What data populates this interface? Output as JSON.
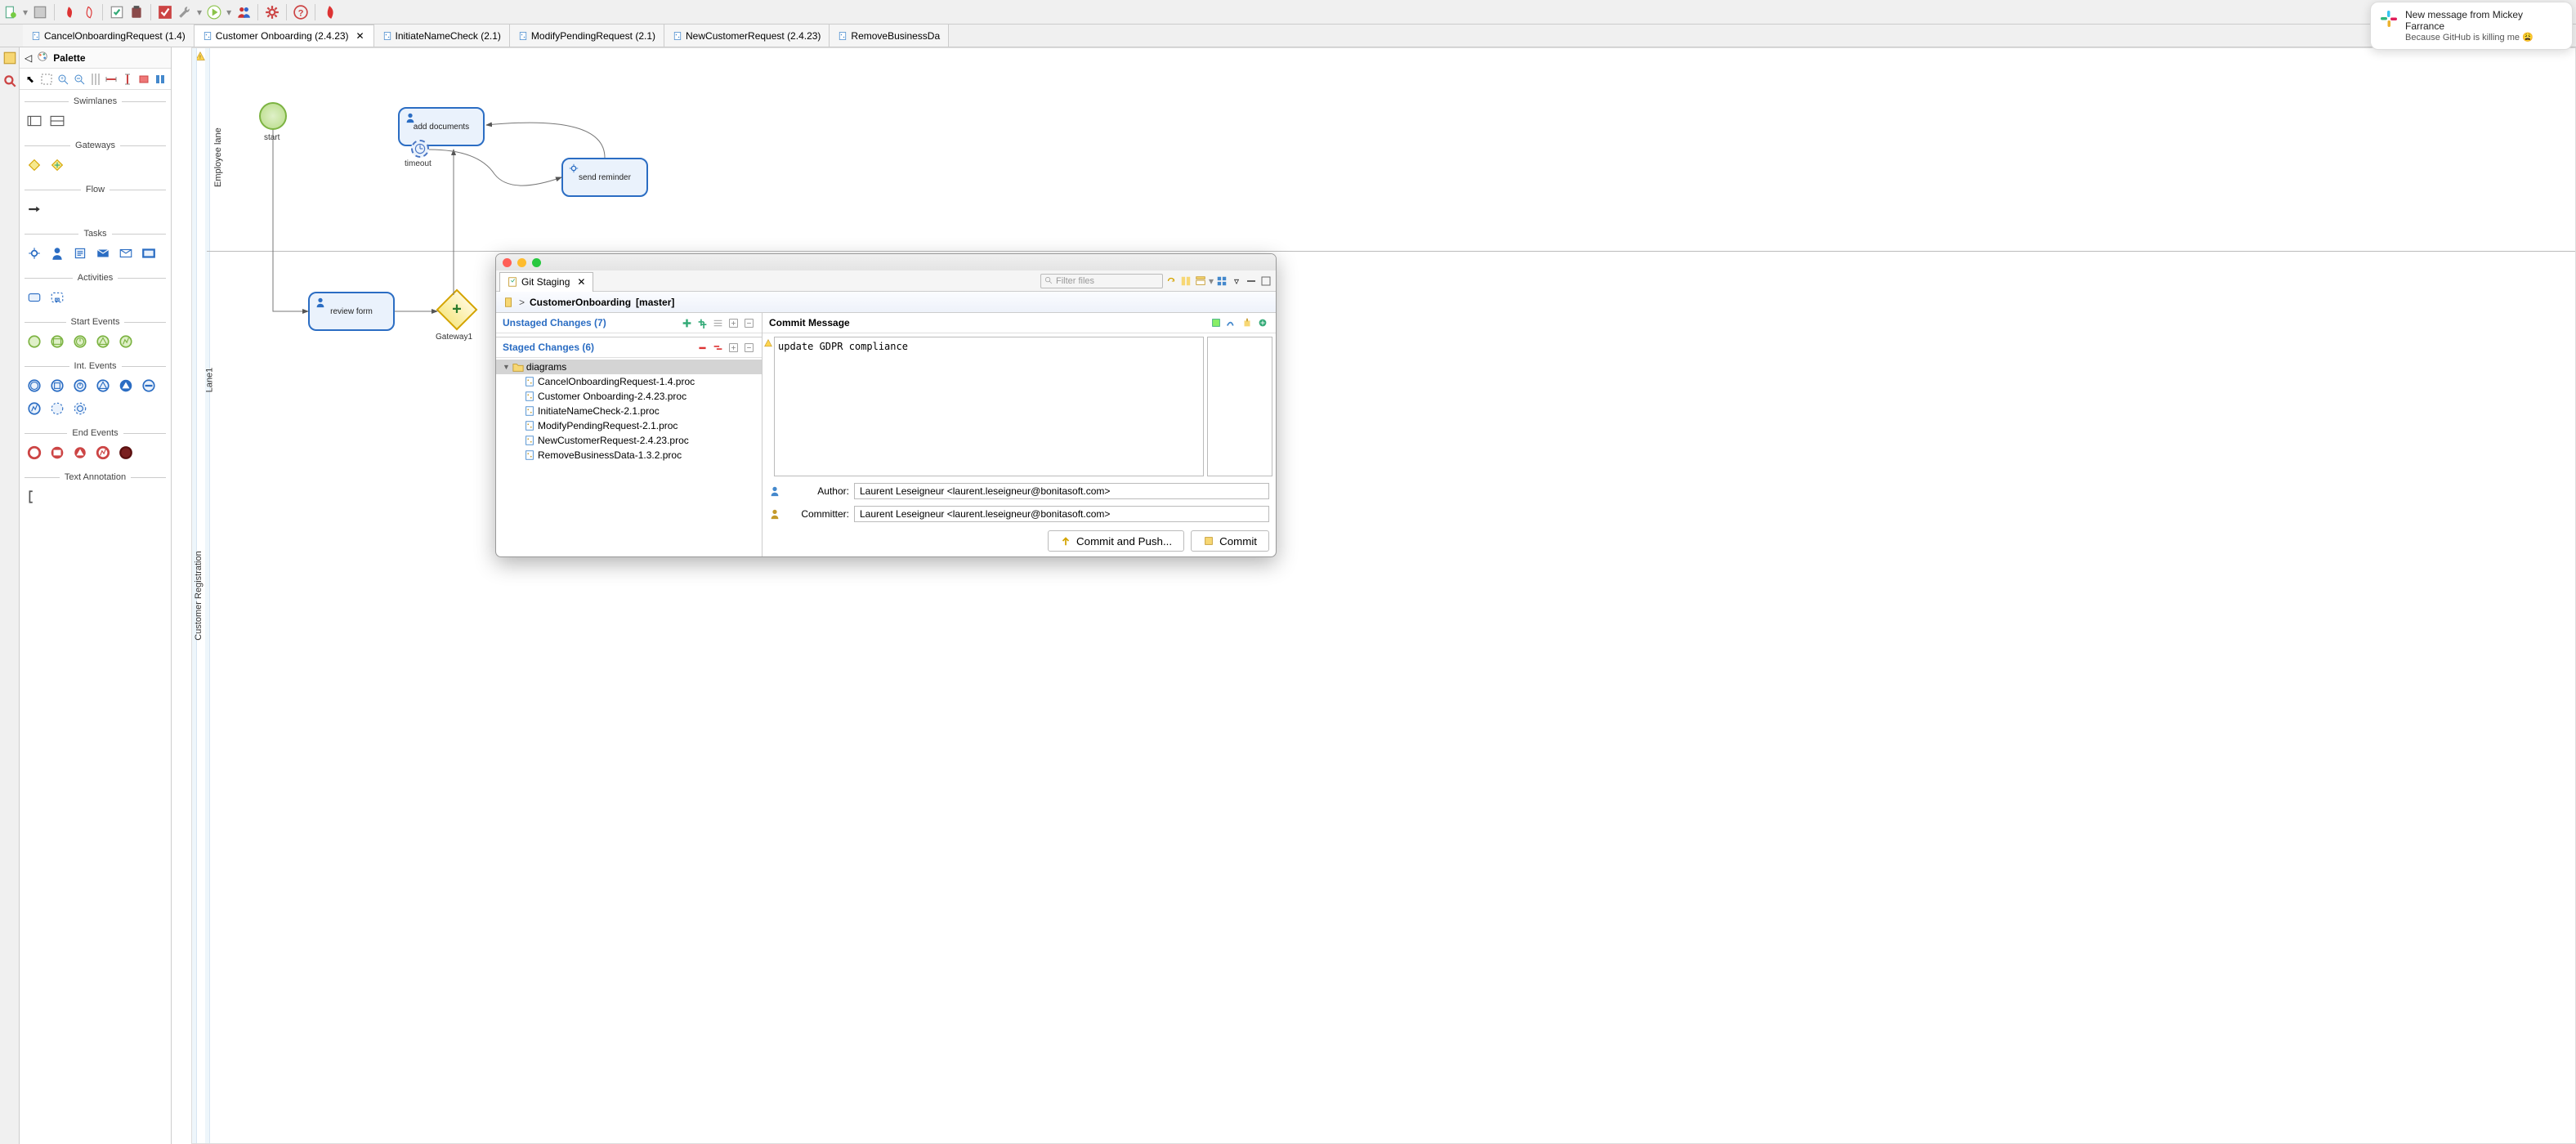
{
  "toolbar": {
    "icons": [
      "new",
      "save",
      "bonita-red",
      "bonita-outline",
      "validate",
      "clipboard",
      "validate2",
      "wrench",
      "play",
      "play-dropdown",
      "people",
      "portal",
      "gear",
      "help",
      "bonita-logo"
    ]
  },
  "tabs": [
    {
      "label": "CancelOnboardingRequest (1.4)",
      "active": false
    },
    {
      "label": "Customer Onboarding (2.4.23)",
      "active": true
    },
    {
      "label": "InitiateNameCheck (2.1)",
      "active": false
    },
    {
      "label": "ModifyPendingRequest (2.1)",
      "active": false
    },
    {
      "label": "NewCustomerRequest (2.4.23)",
      "active": false
    },
    {
      "label": "RemoveBusinessDa",
      "active": false
    }
  ],
  "palette": {
    "title": "Palette",
    "sections": [
      {
        "name": "Swimlanes",
        "items": [
          "pool",
          "lane"
        ]
      },
      {
        "name": "Gateways",
        "items": [
          "xor",
          "and"
        ]
      },
      {
        "name": "Flow",
        "items": [
          "sequence"
        ]
      },
      {
        "name": "Tasks",
        "items": [
          "service",
          "human",
          "script",
          "send",
          "receive",
          "call"
        ]
      },
      {
        "name": "Activities",
        "items": [
          "activity",
          "subprocess"
        ]
      },
      {
        "name": "Start Events",
        "items": [
          "none",
          "message",
          "timer",
          "signal",
          "error"
        ]
      },
      {
        "name": "Int. Events",
        "items": [
          "catch1",
          "catch2",
          "catch3",
          "catch4",
          "throw1",
          "throw2",
          "throw3",
          "boundary1",
          "boundary2"
        ]
      },
      {
        "name": "End Events",
        "items": [
          "end1",
          "end2",
          "end3",
          "end4",
          "end5"
        ]
      },
      {
        "name": "Text Annotation",
        "items": [
          "annotation"
        ]
      }
    ]
  },
  "diagram": {
    "pool": "Customer Registration",
    "lane1": "Employee lane",
    "lane2": "Lane1",
    "start_label": "start",
    "task_add_docs": "add documents",
    "timeout_label": "timeout",
    "task_review": "review form",
    "task_reminder": "send reminder",
    "gateway_label": "Gateway1"
  },
  "git": {
    "tab": "Git Staging",
    "filter_placeholder": "Filter files",
    "repo": "CustomerOnboarding",
    "branch": "[master]",
    "unstaged_title": "Unstaged Changes (7)",
    "staged_title": "Staged Changes (6)",
    "folder": "diagrams",
    "files": [
      "CancelOnboardingRequest-1.4.proc",
      "Customer Onboarding-2.4.23.proc",
      "InitiateNameCheck-2.1.proc",
      "ModifyPendingRequest-2.1.proc",
      "NewCustomerRequest-2.4.23.proc",
      "RemoveBusinessData-1.3.2.proc"
    ],
    "commit_msg_title": "Commit Message",
    "commit_msg": "update GDPR compliance",
    "author_label": "Author:",
    "committer_label": "Committer:",
    "author": "Laurent Leseigneur <laurent.leseigneur@bonitasoft.com>",
    "committer": "Laurent Leseigneur <laurent.leseigneur@bonitasoft.com>",
    "btn_commit_push": "Commit and Push...",
    "btn_commit": "Commit"
  },
  "slack": {
    "title": "New message from Mickey Farrance",
    "body": "Because GitHub is killing me 😩"
  }
}
